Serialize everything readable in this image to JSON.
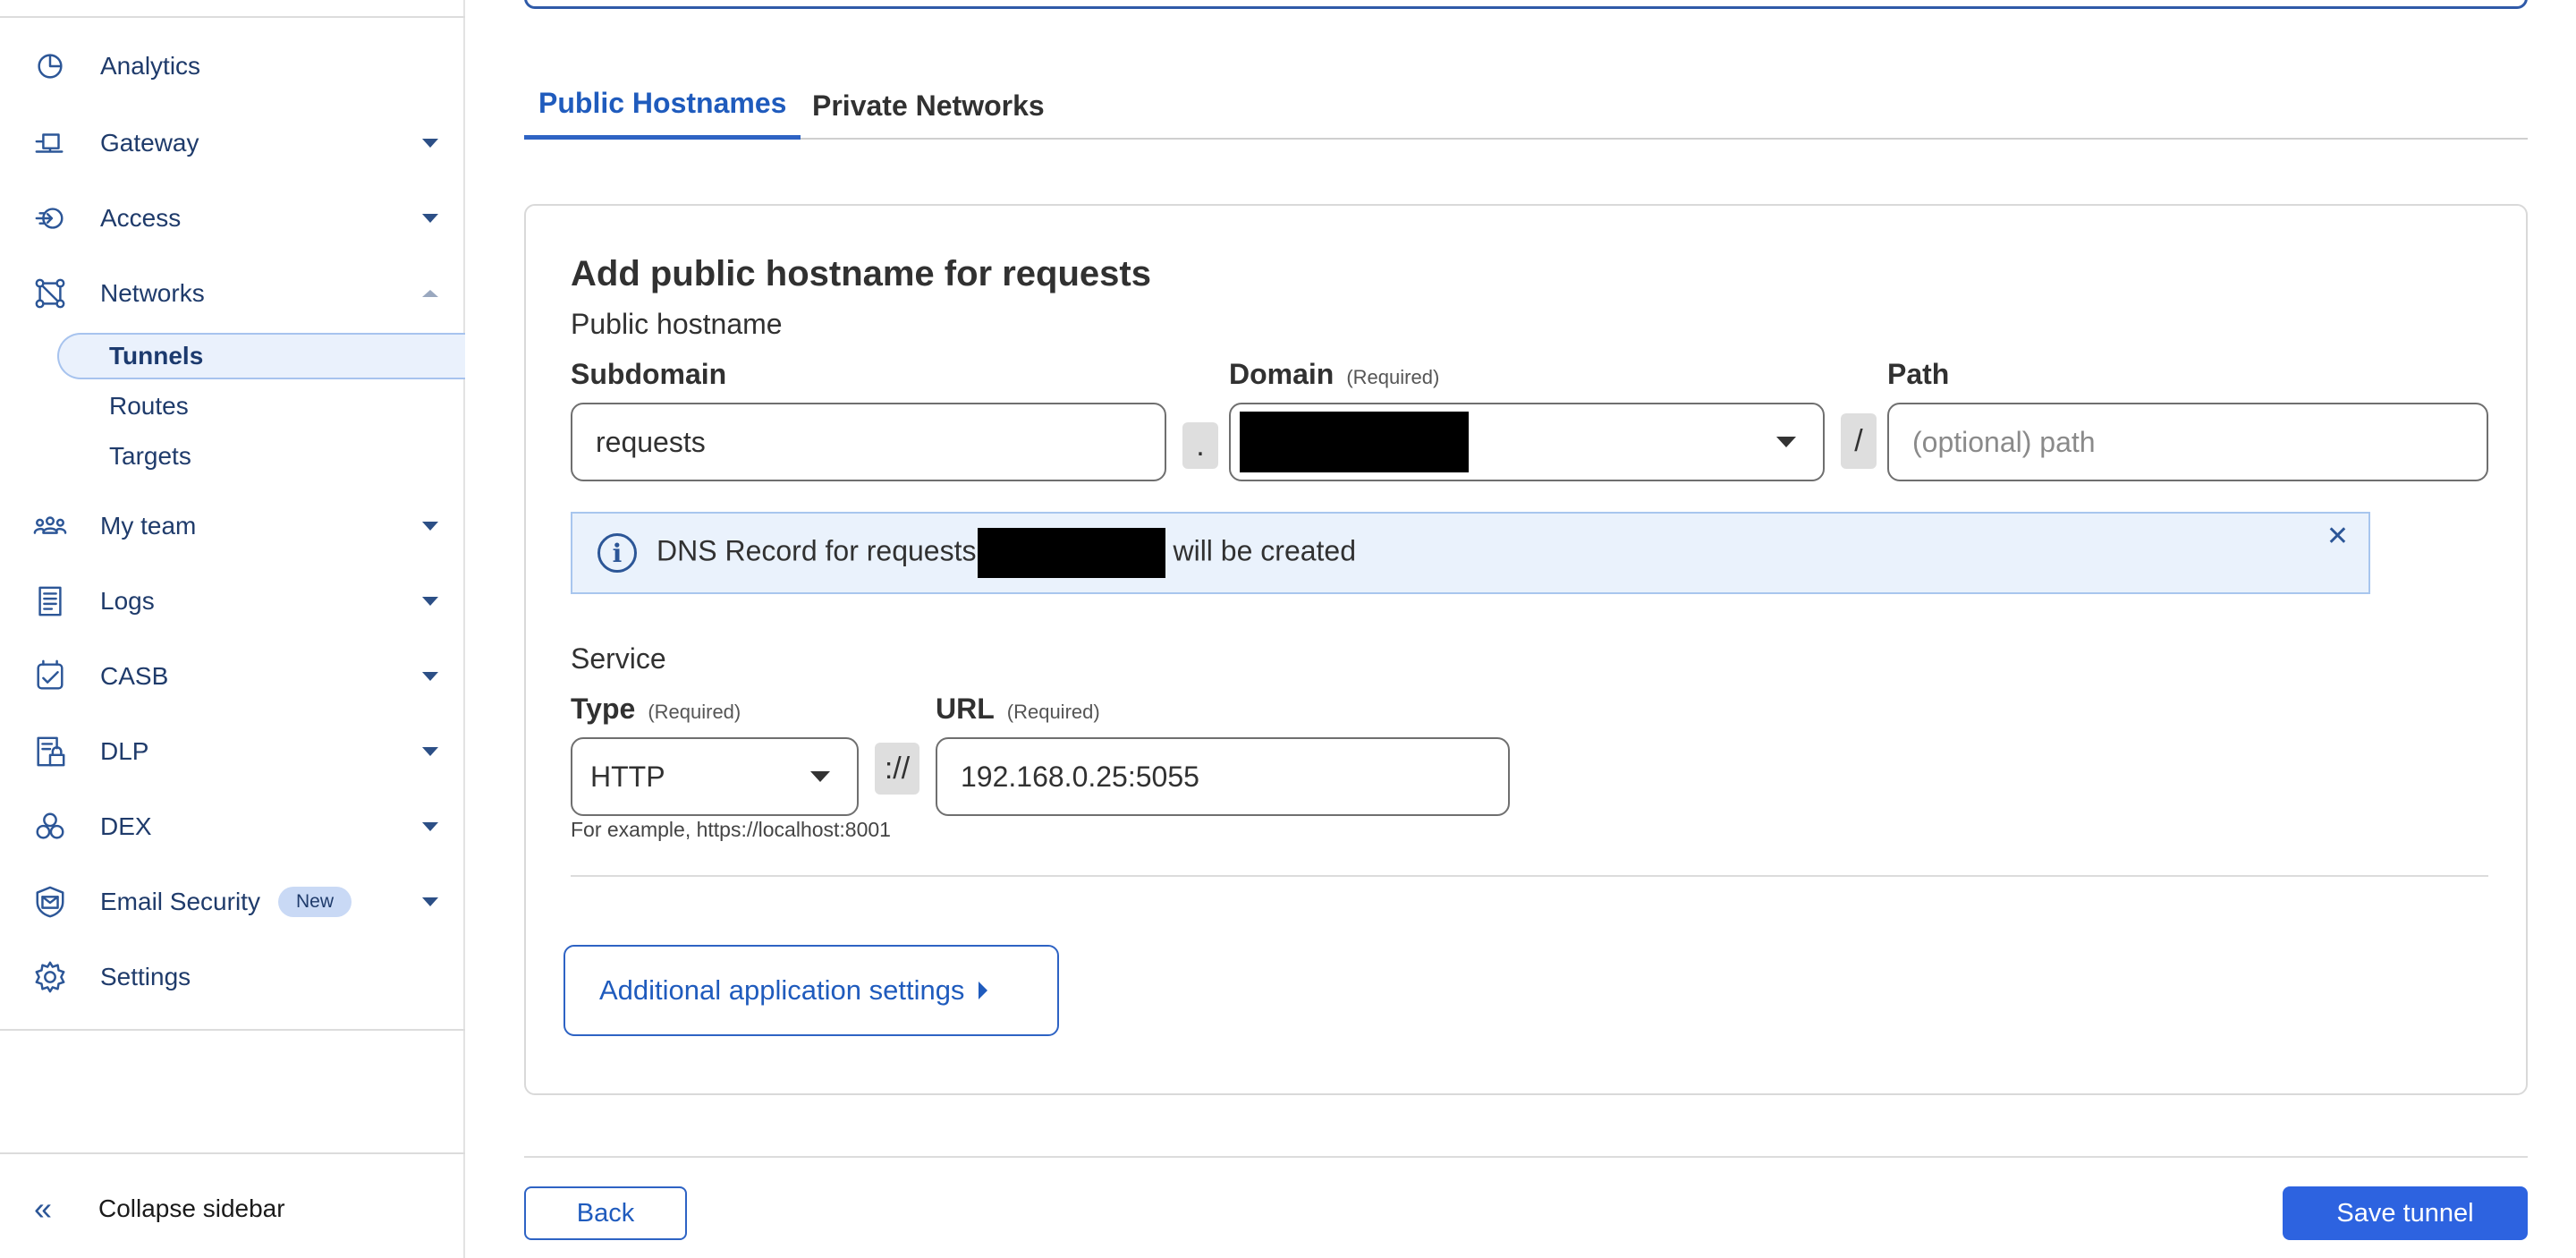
{
  "sidebar": {
    "items": [
      {
        "label": "Analytics",
        "icon": "analytics-icon"
      },
      {
        "label": "Gateway",
        "icon": "gateway-icon"
      },
      {
        "label": "Access",
        "icon": "access-icon"
      },
      {
        "label": "Networks",
        "icon": "networks-icon"
      },
      {
        "label": "My team",
        "icon": "team-icon"
      },
      {
        "label": "Logs",
        "icon": "logs-icon"
      },
      {
        "label": "CASB",
        "icon": "casb-icon"
      },
      {
        "label": "DLP",
        "icon": "dlp-icon"
      },
      {
        "label": "DEX",
        "icon": "dex-icon"
      },
      {
        "label": "Email Security",
        "icon": "email-security-icon",
        "badge": "New"
      },
      {
        "label": "Settings",
        "icon": "gear-icon"
      }
    ],
    "networks_sub": [
      {
        "label": "Tunnels",
        "active": true
      },
      {
        "label": "Routes"
      },
      {
        "label": "Targets"
      }
    ],
    "collapse_label": "Collapse sidebar"
  },
  "tabs": {
    "public": "Public Hostnames",
    "private": "Private Networks"
  },
  "form": {
    "title": "Add public hostname for requests",
    "public_hostname_label": "Public hostname",
    "subdomain_label": "Subdomain",
    "subdomain_value": "requests",
    "dot": ".",
    "domain_label": "Domain",
    "required": "(Required)",
    "slash": "/",
    "path_label": "Path",
    "path_placeholder": "(optional) path",
    "dns_prefix": "DNS Record for requests",
    "dns_suffix": "will be created",
    "service_label": "Service",
    "type_label": "Type",
    "type_value": "HTTP",
    "scheme_sep": "://",
    "url_label": "URL",
    "url_value": "192.168.0.25:5055",
    "hint": "For example, https://localhost:8001",
    "additional_settings": "Additional application settings"
  },
  "footer": {
    "back": "Back",
    "save": "Save tunnel"
  },
  "colors": {
    "accent": "#2e63c4",
    "primary_button": "#2d63e0",
    "info_bg": "#eaf2fc"
  }
}
